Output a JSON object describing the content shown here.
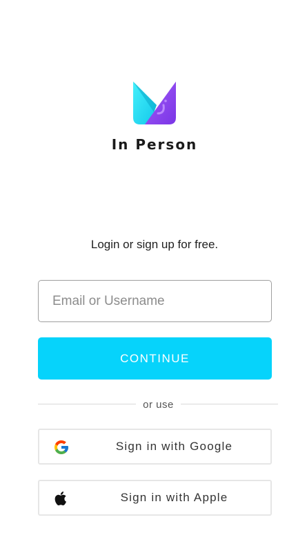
{
  "app": {
    "name": "In Person",
    "logo_icon": "in-person-logo-icon"
  },
  "tagline": "Login or sign up for free.",
  "email": {
    "placeholder": "Email or Username",
    "value": ""
  },
  "continue_label": "CONTINUE",
  "divider_text": "or use",
  "social": {
    "google": {
      "label": "Sign in with Google",
      "icon": "google-icon"
    },
    "apple": {
      "label": "Sign in with Apple",
      "icon": "apple-icon"
    }
  },
  "colors": {
    "accent": "#06d3fb",
    "logo_cyan": "#2fe3f6",
    "logo_purple": "#8a3ef0",
    "text": "#1a1a1a"
  }
}
